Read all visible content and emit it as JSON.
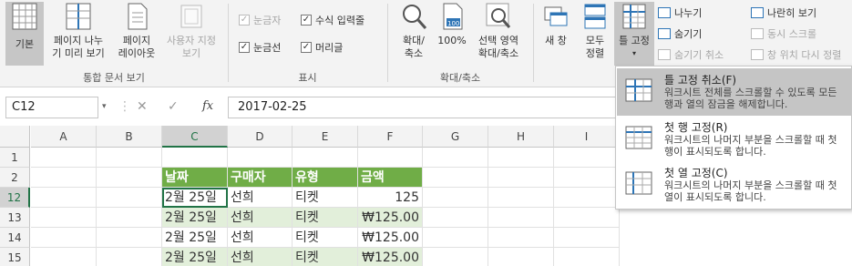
{
  "ribbon": {
    "workbook_views": {
      "normal": "기본",
      "page_break": "페이지 나누\n기 미리 보기",
      "page_layout": "페이지\n레이아웃",
      "custom_views": "사용자 지정\n보기",
      "group_label": "통합 문서 보기"
    },
    "show": {
      "ruler": "눈금자",
      "formula_bar": "수식 입력줄",
      "gridlines": "눈금선",
      "headings": "머리글",
      "group_label": "표시"
    },
    "zoom": {
      "zoom": "확대/\n축소",
      "hundred": "100%",
      "zoom_selection": "선택 영역\n확대/축소",
      "group_label": "확대/축소"
    },
    "window": {
      "new_window": "새 창",
      "arrange_all": "모두\n정렬",
      "freeze_panes": "틀 고정",
      "split": "나누기",
      "hide": "숨기기",
      "unhide": "숨기기 취소",
      "side_by_side": "나란히 보기",
      "sync_scroll": "동시 스크롤",
      "reset_position": "창 위치 다시 정렬"
    }
  },
  "formula_bar": {
    "name_box": "C12",
    "formula": "2017-02-25"
  },
  "grid": {
    "columns": [
      "A",
      "B",
      "C",
      "D",
      "E",
      "F",
      "G",
      "H",
      "I"
    ],
    "header_row": {
      "num": "2",
      "cells": [
        "날짜",
        "구매자",
        "유형",
        "금액"
      ]
    },
    "rows": [
      {
        "num": "1",
        "cells": [
          "",
          "",
          "",
          ""
        ]
      },
      {
        "num": "12",
        "cells": [
          "2월 25일",
          "선희",
          "티켓",
          "125"
        ]
      },
      {
        "num": "13",
        "cells": [
          "2월 25일",
          "선희",
          "티켓",
          "₩125.00"
        ]
      },
      {
        "num": "14",
        "cells": [
          "2월 25일",
          "선희",
          "티켓",
          "₩125.00"
        ]
      },
      {
        "num": "15",
        "cells": [
          "2월 25일",
          "선희",
          "티켓",
          "₩125.00"
        ]
      }
    ]
  },
  "dropdown": {
    "items": [
      {
        "title": "틀 고정 취소(F)",
        "desc": "워크시트 전체를 스크롤할 수 있도록 모든 행과 열의 잠금을 해제합니다."
      },
      {
        "title": "첫 행 고정(R)",
        "desc": "워크시트의 나머지 부분을 스크롤할 때 첫 행이 표시되도록 합니다."
      },
      {
        "title": "첫 열 고정(C)",
        "desc": "워크시트의 나머지 부분을 스크롤할 때 첫 열이 표시되도록 합니다."
      }
    ]
  },
  "colors": {
    "accent_green": "#217346",
    "table_header": "#70ad47",
    "table_band": "#e2efda"
  }
}
